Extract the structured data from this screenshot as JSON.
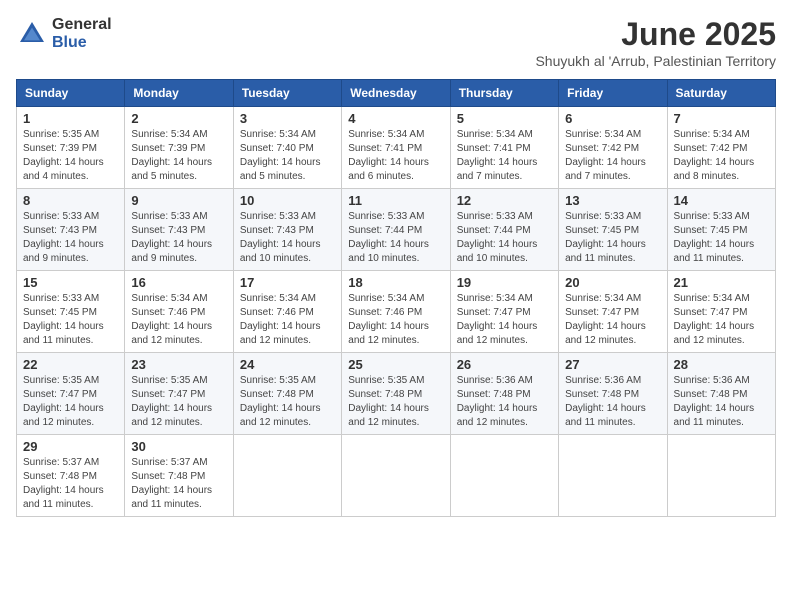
{
  "logo": {
    "general": "General",
    "blue": "Blue"
  },
  "title": "June 2025",
  "subtitle": "Shuyukh al 'Arrub, Palestinian Territory",
  "days_header": [
    "Sunday",
    "Monday",
    "Tuesday",
    "Wednesday",
    "Thursday",
    "Friday",
    "Saturday"
  ],
  "weeks": [
    [
      {
        "day": "1",
        "sunrise": "Sunrise: 5:35 AM",
        "sunset": "Sunset: 7:39 PM",
        "daylight": "Daylight: 14 hours and 4 minutes."
      },
      {
        "day": "2",
        "sunrise": "Sunrise: 5:34 AM",
        "sunset": "Sunset: 7:39 PM",
        "daylight": "Daylight: 14 hours and 5 minutes."
      },
      {
        "day": "3",
        "sunrise": "Sunrise: 5:34 AM",
        "sunset": "Sunset: 7:40 PM",
        "daylight": "Daylight: 14 hours and 5 minutes."
      },
      {
        "day": "4",
        "sunrise": "Sunrise: 5:34 AM",
        "sunset": "Sunset: 7:41 PM",
        "daylight": "Daylight: 14 hours and 6 minutes."
      },
      {
        "day": "5",
        "sunrise": "Sunrise: 5:34 AM",
        "sunset": "Sunset: 7:41 PM",
        "daylight": "Daylight: 14 hours and 7 minutes."
      },
      {
        "day": "6",
        "sunrise": "Sunrise: 5:34 AM",
        "sunset": "Sunset: 7:42 PM",
        "daylight": "Daylight: 14 hours and 7 minutes."
      },
      {
        "day": "7",
        "sunrise": "Sunrise: 5:34 AM",
        "sunset": "Sunset: 7:42 PM",
        "daylight": "Daylight: 14 hours and 8 minutes."
      }
    ],
    [
      {
        "day": "8",
        "sunrise": "Sunrise: 5:33 AM",
        "sunset": "Sunset: 7:43 PM",
        "daylight": "Daylight: 14 hours and 9 minutes."
      },
      {
        "day": "9",
        "sunrise": "Sunrise: 5:33 AM",
        "sunset": "Sunset: 7:43 PM",
        "daylight": "Daylight: 14 hours and 9 minutes."
      },
      {
        "day": "10",
        "sunrise": "Sunrise: 5:33 AM",
        "sunset": "Sunset: 7:43 PM",
        "daylight": "Daylight: 14 hours and 10 minutes."
      },
      {
        "day": "11",
        "sunrise": "Sunrise: 5:33 AM",
        "sunset": "Sunset: 7:44 PM",
        "daylight": "Daylight: 14 hours and 10 minutes."
      },
      {
        "day": "12",
        "sunrise": "Sunrise: 5:33 AM",
        "sunset": "Sunset: 7:44 PM",
        "daylight": "Daylight: 14 hours and 10 minutes."
      },
      {
        "day": "13",
        "sunrise": "Sunrise: 5:33 AM",
        "sunset": "Sunset: 7:45 PM",
        "daylight": "Daylight: 14 hours and 11 minutes."
      },
      {
        "day": "14",
        "sunrise": "Sunrise: 5:33 AM",
        "sunset": "Sunset: 7:45 PM",
        "daylight": "Daylight: 14 hours and 11 minutes."
      }
    ],
    [
      {
        "day": "15",
        "sunrise": "Sunrise: 5:33 AM",
        "sunset": "Sunset: 7:45 PM",
        "daylight": "Daylight: 14 hours and 11 minutes."
      },
      {
        "day": "16",
        "sunrise": "Sunrise: 5:34 AM",
        "sunset": "Sunset: 7:46 PM",
        "daylight": "Daylight: 14 hours and 12 minutes."
      },
      {
        "day": "17",
        "sunrise": "Sunrise: 5:34 AM",
        "sunset": "Sunset: 7:46 PM",
        "daylight": "Daylight: 14 hours and 12 minutes."
      },
      {
        "day": "18",
        "sunrise": "Sunrise: 5:34 AM",
        "sunset": "Sunset: 7:46 PM",
        "daylight": "Daylight: 14 hours and 12 minutes."
      },
      {
        "day": "19",
        "sunrise": "Sunrise: 5:34 AM",
        "sunset": "Sunset: 7:47 PM",
        "daylight": "Daylight: 14 hours and 12 minutes."
      },
      {
        "day": "20",
        "sunrise": "Sunrise: 5:34 AM",
        "sunset": "Sunset: 7:47 PM",
        "daylight": "Daylight: 14 hours and 12 minutes."
      },
      {
        "day": "21",
        "sunrise": "Sunrise: 5:34 AM",
        "sunset": "Sunset: 7:47 PM",
        "daylight": "Daylight: 14 hours and 12 minutes."
      }
    ],
    [
      {
        "day": "22",
        "sunrise": "Sunrise: 5:35 AM",
        "sunset": "Sunset: 7:47 PM",
        "daylight": "Daylight: 14 hours and 12 minutes."
      },
      {
        "day": "23",
        "sunrise": "Sunrise: 5:35 AM",
        "sunset": "Sunset: 7:47 PM",
        "daylight": "Daylight: 14 hours and 12 minutes."
      },
      {
        "day": "24",
        "sunrise": "Sunrise: 5:35 AM",
        "sunset": "Sunset: 7:48 PM",
        "daylight": "Daylight: 14 hours and 12 minutes."
      },
      {
        "day": "25",
        "sunrise": "Sunrise: 5:35 AM",
        "sunset": "Sunset: 7:48 PM",
        "daylight": "Daylight: 14 hours and 12 minutes."
      },
      {
        "day": "26",
        "sunrise": "Sunrise: 5:36 AM",
        "sunset": "Sunset: 7:48 PM",
        "daylight": "Daylight: 14 hours and 12 minutes."
      },
      {
        "day": "27",
        "sunrise": "Sunrise: 5:36 AM",
        "sunset": "Sunset: 7:48 PM",
        "daylight": "Daylight: 14 hours and 11 minutes."
      },
      {
        "day": "28",
        "sunrise": "Sunrise: 5:36 AM",
        "sunset": "Sunset: 7:48 PM",
        "daylight": "Daylight: 14 hours and 11 minutes."
      }
    ],
    [
      {
        "day": "29",
        "sunrise": "Sunrise: 5:37 AM",
        "sunset": "Sunset: 7:48 PM",
        "daylight": "Daylight: 14 hours and 11 minutes."
      },
      {
        "day": "30",
        "sunrise": "Sunrise: 5:37 AM",
        "sunset": "Sunset: 7:48 PM",
        "daylight": "Daylight: 14 hours and 11 minutes."
      },
      null,
      null,
      null,
      null,
      null
    ]
  ]
}
